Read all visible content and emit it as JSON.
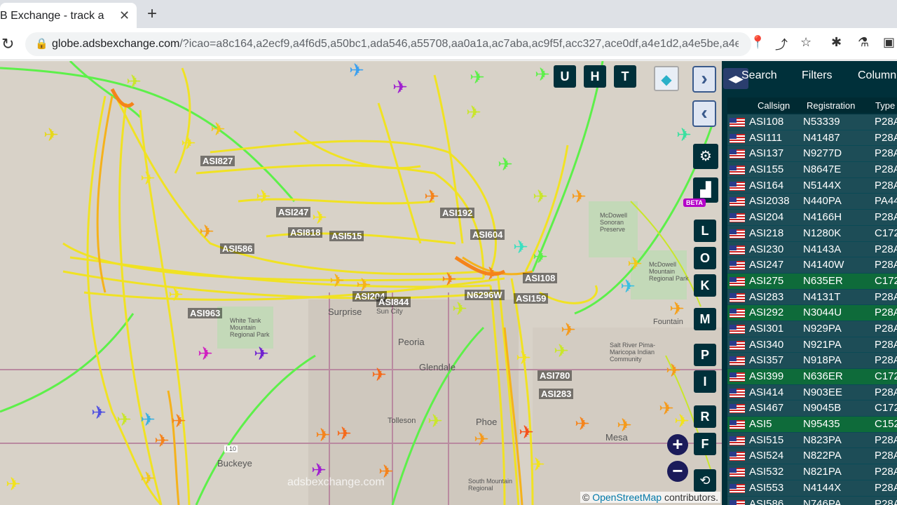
{
  "browser": {
    "tab_title": "B Exchange - track a",
    "tab_close": "✕",
    "new_tab": "+",
    "url_host": "globe.adsbexchange.com",
    "url_rest": "/?icao=a8c164,a2ecf9,a4f6d5,a50bc1,ada546,a55708,aa0a1a,ac7aba,ac9f5f,acc327,ace0df,a4e1d2,a4e5be,a4e..."
  },
  "map": {
    "place_labels": [
      "Surprise",
      "Sun City",
      "Peoria",
      "Glendale",
      "Tolleson",
      "Buckeye",
      "Mesa",
      "Phoe",
      "McDowell Mountain Regional Park",
      "White Tank Mountain Regional Park",
      "McDowell Sonoran Preserve",
      "Fountain",
      "Salt River Pima-Maricopa Indian Community",
      "I 10",
      "South Mountain Regional"
    ],
    "aircraft_labels": [
      "ASI827",
      "ASI247",
      "ASI818",
      "ASI515",
      "ASI586",
      "ASI963",
      "ASI204",
      "ASI844",
      "N6296W",
      "ASI159",
      "ASI108",
      "ASI604",
      "ASI192",
      "ASI780",
      "ASI283"
    ],
    "controls": {
      "u": "U",
      "h": "H",
      "t": "T",
      "l": "L",
      "o": "O",
      "k": "K",
      "m": "M",
      "p": "P",
      "i": "I",
      "r": "R",
      "f": "F",
      "beta": "BETA",
      "zoom_in": "+",
      "zoom_out": "−"
    },
    "watermark": "adsbexchange.com",
    "attribution_prefix": "©",
    "attribution_link": "OpenStreetMap",
    "attribution_suffix": "contributors."
  },
  "sidebar": {
    "tabs": [
      "Search",
      "Filters",
      "Column"
    ],
    "columns": [
      "Callsign",
      "Registration",
      "Type"
    ],
    "rows": [
      {
        "callsign": "ASI108",
        "reg": "N53339",
        "type": "P28A",
        "hl": false
      },
      {
        "callsign": "ASI111",
        "reg": "N41487",
        "type": "P28A",
        "hl": false
      },
      {
        "callsign": "ASI137",
        "reg": "N9277D",
        "type": "P28A",
        "hl": false
      },
      {
        "callsign": "ASI155",
        "reg": "N8647E",
        "type": "P28A",
        "hl": false
      },
      {
        "callsign": "ASI164",
        "reg": "N5144X",
        "type": "P28A",
        "hl": false
      },
      {
        "callsign": "ASI2038",
        "reg": "N440PA",
        "type": "PA44",
        "hl": false
      },
      {
        "callsign": "ASI204",
        "reg": "N4166H",
        "type": "P28A",
        "hl": false
      },
      {
        "callsign": "ASI218",
        "reg": "N1280K",
        "type": "C172",
        "hl": false
      },
      {
        "callsign": "ASI230",
        "reg": "N4143A",
        "type": "P28A",
        "hl": false
      },
      {
        "callsign": "ASI247",
        "reg": "N4140W",
        "type": "P28A",
        "hl": false
      },
      {
        "callsign": "ASI275",
        "reg": "N635ER",
        "type": "C172",
        "hl": true
      },
      {
        "callsign": "ASI283",
        "reg": "N4131T",
        "type": "P28A",
        "hl": false
      },
      {
        "callsign": "ASI292",
        "reg": "N3044U",
        "type": "P28A",
        "hl": true
      },
      {
        "callsign": "ASI301",
        "reg": "N929PA",
        "type": "P28A",
        "hl": false
      },
      {
        "callsign": "ASI340",
        "reg": "N921PA",
        "type": "P28A",
        "hl": false
      },
      {
        "callsign": "ASI357",
        "reg": "N918PA",
        "type": "P28A",
        "hl": false
      },
      {
        "callsign": "ASI399",
        "reg": "N636ER",
        "type": "C172",
        "hl": true
      },
      {
        "callsign": "ASI414",
        "reg": "N903EE",
        "type": "P28A",
        "hl": false
      },
      {
        "callsign": "ASI467",
        "reg": "N9045B",
        "type": "C172",
        "hl": false
      },
      {
        "callsign": "ASI5",
        "reg": "N95435",
        "type": "C152",
        "hl": true
      },
      {
        "callsign": "ASI515",
        "reg": "N823PA",
        "type": "P28A",
        "hl": false
      },
      {
        "callsign": "ASI524",
        "reg": "N822PA",
        "type": "P28A",
        "hl": false
      },
      {
        "callsign": "ASI532",
        "reg": "N821PA",
        "type": "P28A",
        "hl": false
      },
      {
        "callsign": "ASI553",
        "reg": "N4144X",
        "type": "P28A",
        "hl": false
      },
      {
        "callsign": "ASI586",
        "reg": "N746PA",
        "type": "P28A",
        "hl": false
      }
    ]
  },
  "colors": {
    "sidebar_bg": "#00303a",
    "row_bg": "#1d4d57",
    "row_highlight": "#0e6b3a",
    "track_yellow": "#f2e31b",
    "track_orange": "#f59a1b",
    "track_green": "#5df04a"
  }
}
